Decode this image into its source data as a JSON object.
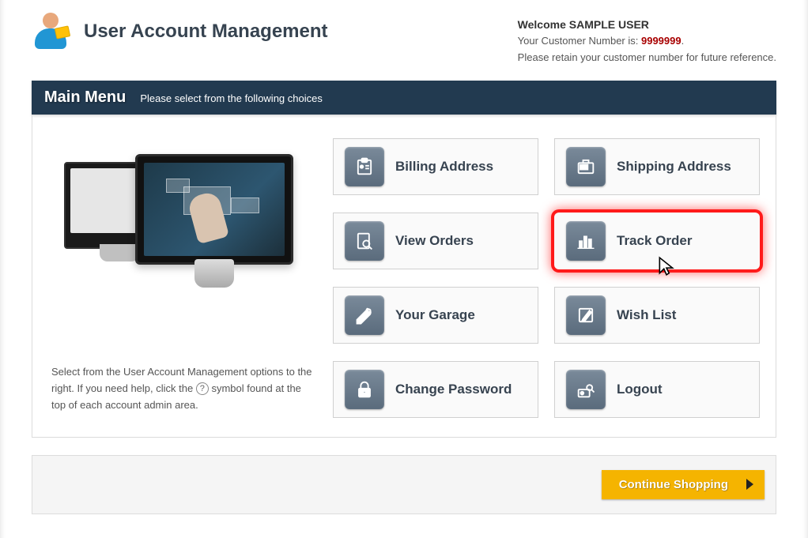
{
  "header": {
    "page_title": "User Account Management",
    "welcome_prefix": "Welcome ",
    "welcome_user": "SAMPLE USER",
    "customer_label": "Your Customer Number is: ",
    "customer_number": "9999999",
    "customer_suffix": ".",
    "retain_text": "Please retain your customer number for future reference."
  },
  "menu_bar": {
    "title": "Main Menu",
    "subtitle": "Please select from the following choices"
  },
  "left_panel": {
    "help_text_1": "Select from the User Account Management options to the right. If you need help, click the ",
    "help_text_2": " symbol found at the top of each account admin area."
  },
  "tiles": {
    "billing": "Billing Address",
    "shipping": "Shipping Address",
    "view_orders": "View Orders",
    "track_order": "Track Order",
    "garage": "Your Garage",
    "wishlist": "Wish List",
    "change_pw": "Change Password",
    "logout": "Logout"
  },
  "footer": {
    "continue_label": "Continue Shopping"
  }
}
